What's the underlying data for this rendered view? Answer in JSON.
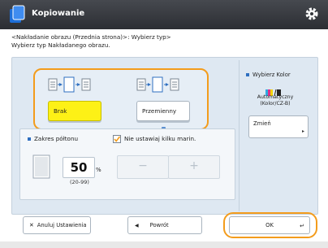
{
  "header": {
    "title": "Kopiowanie",
    "app_icon": "copy-app-icon",
    "settings_icon": "gear-icon"
  },
  "instructions": {
    "line1": "<Nakładanie obrazu (Przednia strona)>: Wybierz typ>",
    "line2": "Wybierz typ Nakładanego obrazu."
  },
  "layout_options": {
    "none_label": "Brak",
    "alternate_label": "Przemienny",
    "selected": "Brak"
  },
  "zoom": {
    "label": "Zakres półtonu",
    "value": "50",
    "unit": "%",
    "range": "(20-99)",
    "minus_label": "−",
    "plus_label": "+"
  },
  "no_margin": {
    "label": "Nie ustawiaj kilku marin."
  },
  "color": {
    "label": "Wybierz Kolor",
    "value_line1": "Automatyczny",
    "value_line2": "(Kolor/CZ-B)",
    "change_label": "Zmień"
  },
  "footer": {
    "cancel_label": "Anuluj Ustawienia",
    "back_label": "Powrót",
    "ok_label": "OK"
  },
  "colors": {
    "header_bg": "#34373c",
    "accent_orange": "#f39c1c",
    "selected_yellow": "#fdf116",
    "panel_blue": "#dee8f2"
  }
}
